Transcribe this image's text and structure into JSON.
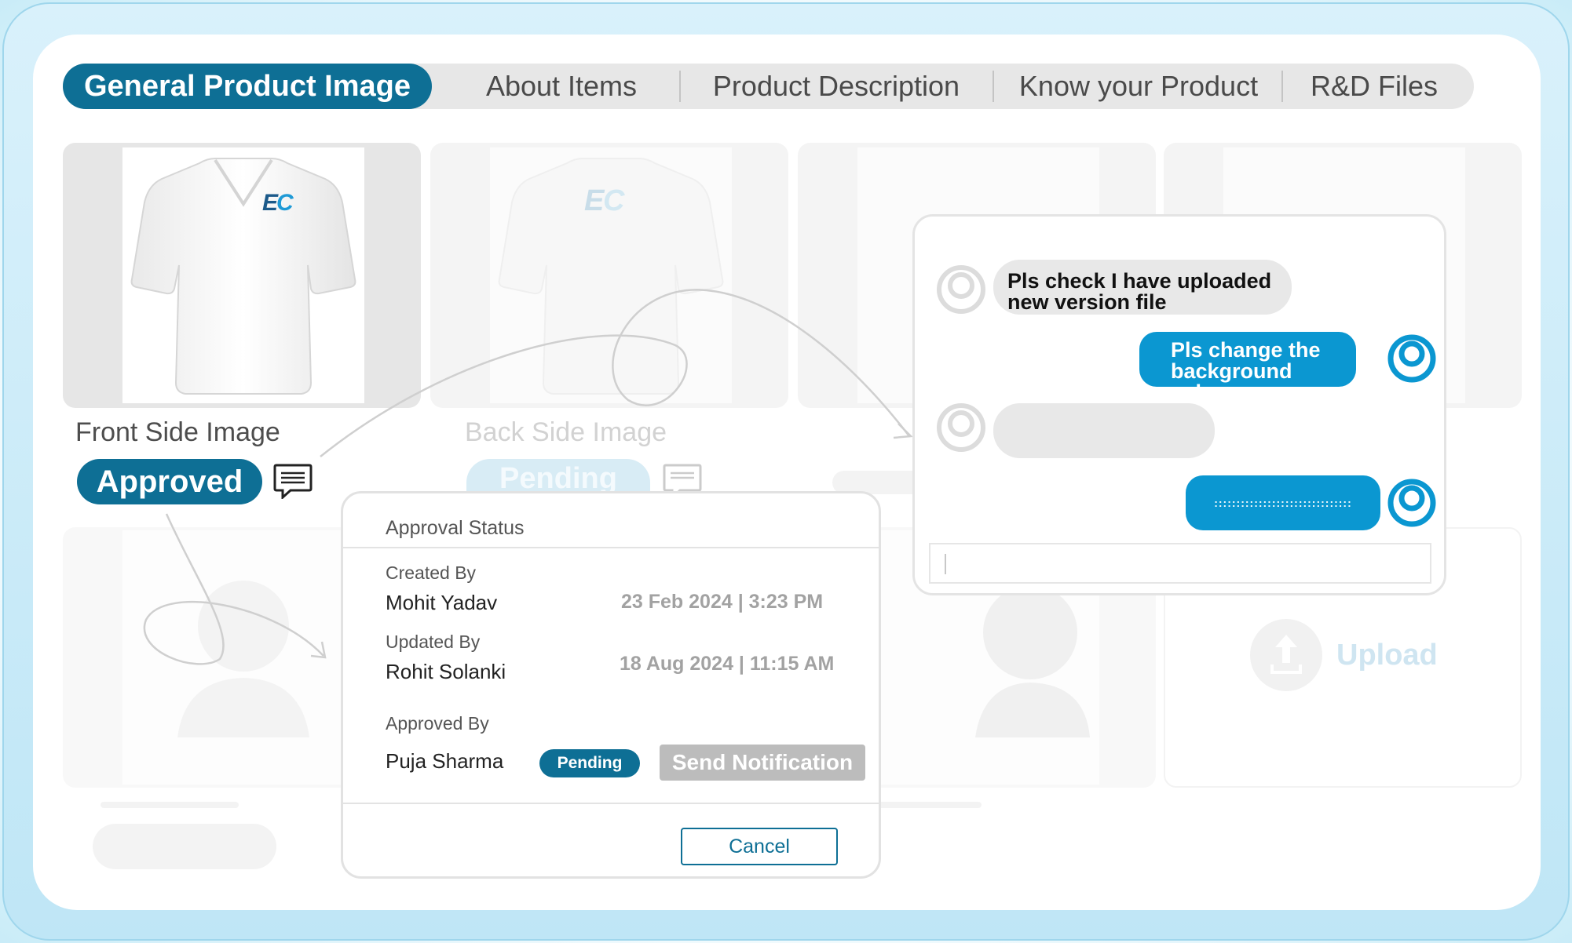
{
  "tabs": {
    "active": "General Product Image",
    "items": [
      "About Items",
      "Product Description",
      "Know your Product",
      "R&D Files"
    ]
  },
  "cards": {
    "front": {
      "label": "Front Side Image",
      "status": "Approved",
      "logo": "EC"
    },
    "back": {
      "label": "Back Side Image",
      "status": "Pending",
      "logo": "EC"
    }
  },
  "upload": {
    "label": "Upload"
  },
  "approval": {
    "title": "Approval Status",
    "created_label": "Created By",
    "created_name": "Mohit Yadav",
    "created_date": "23 Feb 2024 | 3:23 PM",
    "updated_label": "Updated By",
    "updated_name": "Rohit Solanki",
    "updated_date": "18 Aug 2024 | 11:15 AM",
    "approved_label": "Approved By",
    "approved_name": "Puja Sharma",
    "approved_status": "Pending",
    "send_label": "Send Notification",
    "cancel_label": "Cancel"
  },
  "chat": {
    "msg1_line1": "Pls check I have uploaded",
    "msg1_line2": "new version file",
    "msg2_line1": "Pls change the",
    "msg2_line2": "background color",
    "msg4": ":::::::::::::::::::::::::::::::"
  },
  "colors": {
    "brand": "#0e6f95",
    "chat_blue": "#0b97d1",
    "muted": "#bcbcbc"
  }
}
